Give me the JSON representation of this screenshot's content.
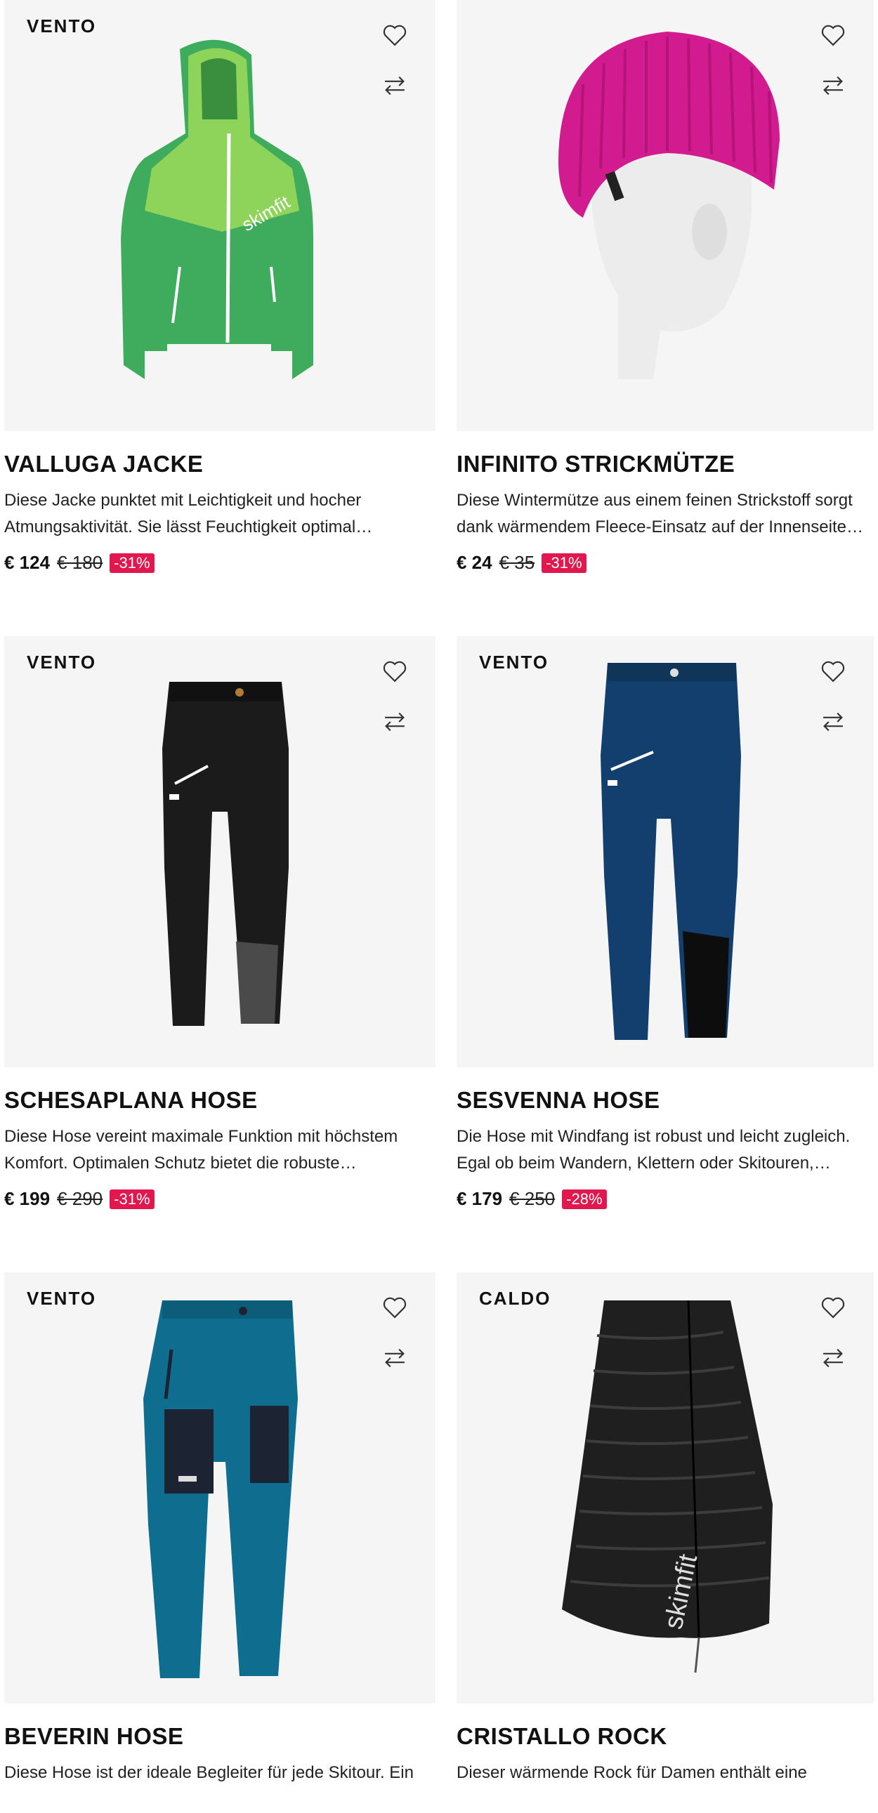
{
  "products": [
    {
      "brand": "VENTO",
      "title": "VALLUGA JACKE",
      "description": "Diese Jacke punktet mit Leichtigkeit und hocher Atmungsaktivität. Sie lässt Feuchtigkeit optimal…",
      "price": "€ 124",
      "old_price": "€ 180",
      "discount": "-31%",
      "image": "green-hooded-jacket"
    },
    {
      "brand": "",
      "title": "INFINITO STRICKMÜTZE",
      "description": "Diese Wintermütze aus einem feinen Strickstoff sorgt dank wärmendem Fleece-Einsatz auf der Innenseite fü…",
      "price": "€ 24",
      "old_price": "€ 35",
      "discount": "-31%",
      "image": "pink-knit-beanie"
    },
    {
      "brand": "VENTO",
      "title": "SCHESAPLANA HOSE",
      "description": "Diese Hose vereint maximale Funktion mit höchstem Komfort. Optimalen Schutz bietet die robuste…",
      "price": "€ 199",
      "old_price": "€ 290",
      "discount": "-31%",
      "image": "black-pants"
    },
    {
      "brand": "VENTO",
      "title": "SESVENNA HOSE",
      "description": "Die Hose mit Windfang ist robust und leicht zugleich. Egal ob beim Wandern, Klettern oder Skitouren, Wärm…",
      "price": "€ 179",
      "old_price": "€ 250",
      "discount": "-28%",
      "image": "navy-pants"
    },
    {
      "brand": "VENTO",
      "title": "BEVERIN HOSE",
      "description": "Diese Hose ist der ideale Begleiter für jede Skitour. Ein",
      "price": "",
      "old_price": "",
      "discount": "",
      "image": "teal-pants"
    },
    {
      "brand": "CALDO",
      "title": "CRISTALLO ROCK",
      "description": "Dieser wärmende Rock für Damen enthält eine",
      "price": "",
      "old_price": "",
      "discount": "",
      "image": "black-quilted-skirt"
    }
  ],
  "icons": {
    "favorite": "heart-icon",
    "compare": "compare-arrows-icon"
  },
  "colors": {
    "discount_bg": "#e2174d",
    "image_bg": "#f5f5f5"
  }
}
